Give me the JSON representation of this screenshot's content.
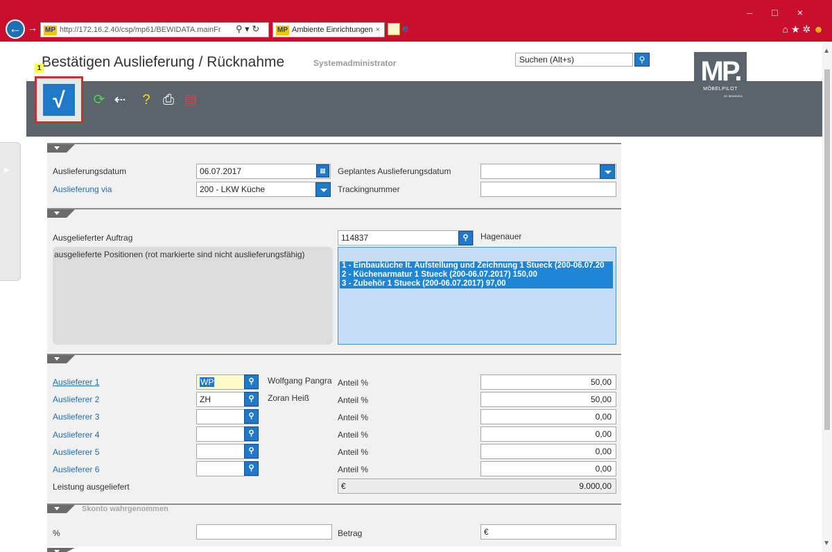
{
  "browser": {
    "url": "http://172.16.2.40/csp/mp61/BEWIDATA.mainFr",
    "url_icon_label": "MP",
    "tab_title": "Ambiente Einrichtungen",
    "tab_icon_label": "MP"
  },
  "header": {
    "title": "Bestätigen Auslieferung / Rücknahme",
    "user": "Systemadministrator",
    "search_placeholder": "Suchen (Alt+s)"
  },
  "logo": {
    "big": "MP.",
    "small": "MÖBELPILOT",
    "tiny": "BY BEWIDATA"
  },
  "toolbar": {
    "badge": "1",
    "confirm_symbol": "√"
  },
  "section1": {
    "auslieferungsdatum_label": "Auslieferungsdatum",
    "auslieferungsdatum_value": "06.07.2017",
    "auslieferung_via_label": "Auslieferung via",
    "auslieferung_via_value": "200 - LKW Küche",
    "geplantes_label": "Geplantes Auslieferungsdatum",
    "geplantes_value": "",
    "tracking_label": "Trackingnummer",
    "tracking_value": ""
  },
  "section2": {
    "auftrag_label": "Ausgelieferter Auftrag",
    "auftrag_value": "114837",
    "kunde": "Hagenauer",
    "positionen_label": "ausgelieferte Positionen (rot markierte sind nicht auslieferungsfähig)",
    "positionen": [
      "1 - Einbauküche lt. Aufstellung und Zeichnung 1 Stueck (200-06.07.20",
      "2 - Küchenarmatur 1 Stueck (200-06.07.2017) 150,00",
      "3 - Zubehör 1 Stueck (200-06.07.2017) 97,00"
    ]
  },
  "section3": {
    "anteil_label": "Anteil %",
    "auslieferer": [
      {
        "label": "Auslieferer 1",
        "code": "WP",
        "name": "Wolfgang Pangra",
        "anteil": "50,00"
      },
      {
        "label": "Auslieferer 2",
        "code": "ZH",
        "name": "Zoran Heiß",
        "anteil": "50,00"
      },
      {
        "label": "Auslieferer 3",
        "code": "",
        "name": "",
        "anteil": "0,00"
      },
      {
        "label": "Auslieferer 4",
        "code": "",
        "name": "",
        "anteil": "0,00"
      },
      {
        "label": "Auslieferer 5",
        "code": "",
        "name": "",
        "anteil": "0,00"
      },
      {
        "label": "Auslieferer 6",
        "code": "",
        "name": "",
        "anteil": "0,00"
      }
    ],
    "leistung_label": "Leistung ausgeliefert",
    "leistung_currency": "€",
    "leistung_value": "9.000,00"
  },
  "section4": {
    "title": "Skonto wahrgenommen",
    "prozent_label": "%",
    "prozent_value": "",
    "betrag_label": "Betrag",
    "betrag_currency": "€"
  }
}
